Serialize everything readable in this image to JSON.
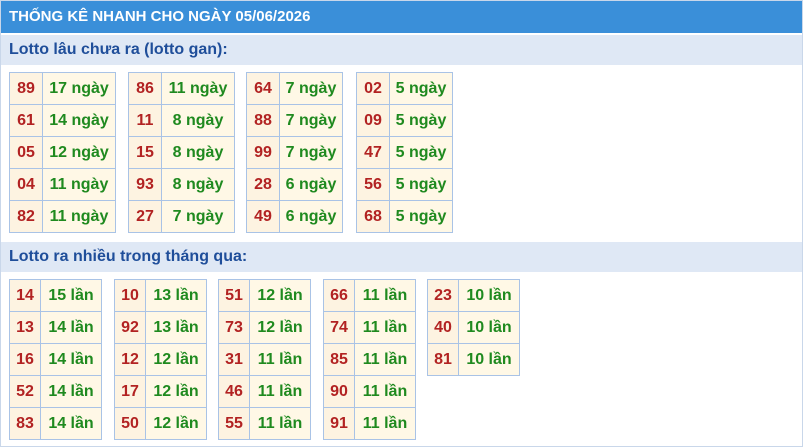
{
  "title": "THỐNG KÊ NHANH CHO NGÀY 05/06/2026",
  "gan_heading": "Lotto lâu chưa ra (lotto gan):",
  "gan_groups": [
    [
      {
        "n": "89",
        "v": "17 ngày"
      },
      {
        "n": "61",
        "v": "14 ngày"
      },
      {
        "n": "05",
        "v": "12 ngày"
      },
      {
        "n": "04",
        "v": "11 ngày"
      },
      {
        "n": "82",
        "v": "11 ngày"
      }
    ],
    [
      {
        "n": "86",
        "v": "11 ngày"
      },
      {
        "n": "11",
        "v": "8 ngày"
      },
      {
        "n": "15",
        "v": "8 ngày"
      },
      {
        "n": "93",
        "v": "8 ngày"
      },
      {
        "n": "27",
        "v": "7 ngày"
      }
    ],
    [
      {
        "n": "64",
        "v": "7 ngày"
      },
      {
        "n": "88",
        "v": "7 ngày"
      },
      {
        "n": "99",
        "v": "7 ngày"
      },
      {
        "n": "28",
        "v": "6 ngày"
      },
      {
        "n": "49",
        "v": "6 ngày"
      }
    ],
    [
      {
        "n": "02",
        "v": "5 ngày"
      },
      {
        "n": "09",
        "v": "5 ngày"
      },
      {
        "n": "47",
        "v": "5 ngày"
      },
      {
        "n": "56",
        "v": "5 ngày"
      },
      {
        "n": "68",
        "v": "5 ngày"
      }
    ]
  ],
  "freq_heading": "Lotto ra nhiều trong tháng qua:",
  "freq_groups": [
    [
      {
        "n": "14",
        "v": "15 lần"
      },
      {
        "n": "13",
        "v": "14 lần"
      },
      {
        "n": "16",
        "v": "14 lần"
      },
      {
        "n": "52",
        "v": "14 lần"
      },
      {
        "n": "83",
        "v": "14 lần"
      }
    ],
    [
      {
        "n": "10",
        "v": "13 lần"
      },
      {
        "n": "92",
        "v": "13 lần"
      },
      {
        "n": "12",
        "v": "12 lần"
      },
      {
        "n": "17",
        "v": "12 lần"
      },
      {
        "n": "50",
        "v": "12 lần"
      }
    ],
    [
      {
        "n": "51",
        "v": "12 lần"
      },
      {
        "n": "73",
        "v": "12 lần"
      },
      {
        "n": "31",
        "v": "11 lần"
      },
      {
        "n": "46",
        "v": "11 lần"
      },
      {
        "n": "55",
        "v": "11 lần"
      }
    ],
    [
      {
        "n": "66",
        "v": "11 lần"
      },
      {
        "n": "74",
        "v": "11 lần"
      },
      {
        "n": "85",
        "v": "11 lần"
      },
      {
        "n": "90",
        "v": "11 lần"
      },
      {
        "n": "91",
        "v": "11 lần"
      }
    ],
    [
      {
        "n": "23",
        "v": "10 lần"
      },
      {
        "n": "40",
        "v": "10 lần"
      },
      {
        "n": "81",
        "v": "10 lần"
      }
    ]
  ],
  "colors": {
    "title_bg": "#3a8fd9",
    "section_bg": "#dfe8f5",
    "number": "#b22222",
    "value": "#1f8a1f",
    "border": "#a9c3e6"
  }
}
